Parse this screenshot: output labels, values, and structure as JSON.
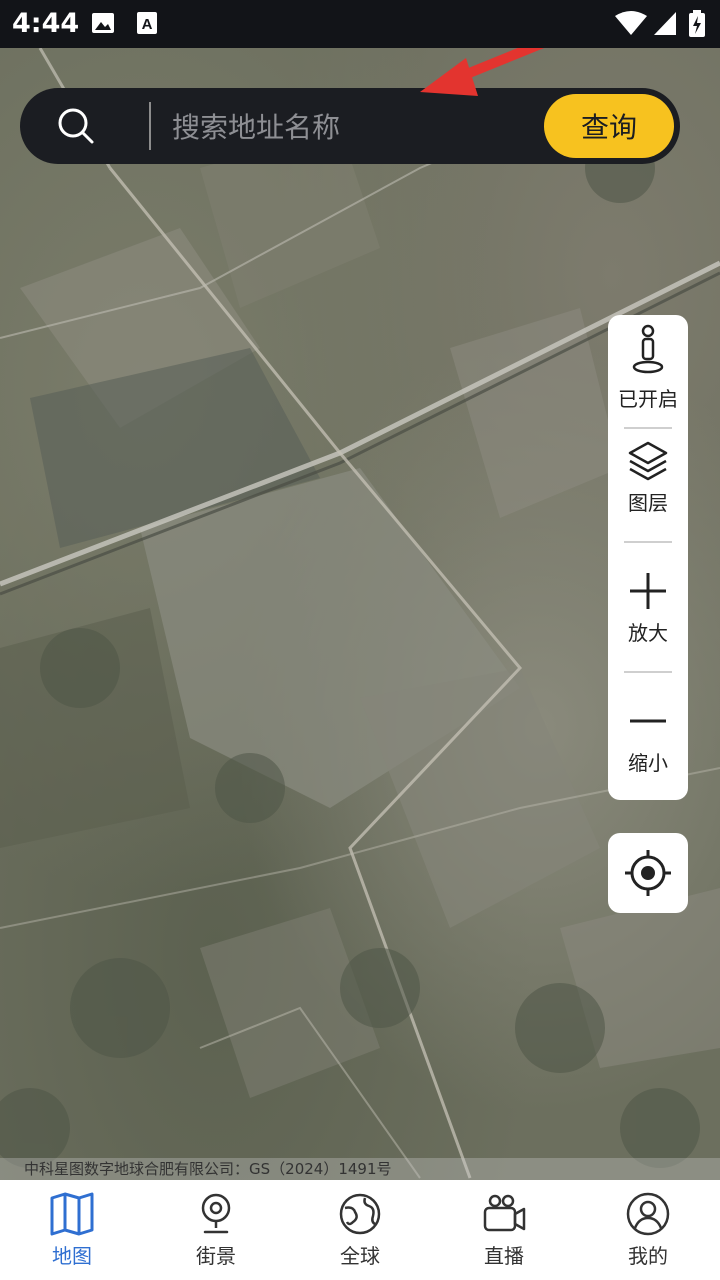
{
  "status_bar": {
    "time": "4:44",
    "icons": [
      "image-icon",
      "a-notification-icon",
      "wifi-icon",
      "signal-icon",
      "battery-charging-icon"
    ]
  },
  "search": {
    "placeholder": "搜索地址名称",
    "button_label": "查询",
    "button_color": "#f7c21f",
    "bar_color": "#1b1d22"
  },
  "toolbar": {
    "street_view_toggle": {
      "label": "已开启",
      "icon": "person-pin-icon"
    },
    "layers": {
      "label": "图层",
      "icon": "layers-icon"
    },
    "zoom_in": {
      "label": "放大",
      "icon": "plus-icon"
    },
    "zoom_out": {
      "label": "缩小",
      "icon": "minus-icon"
    }
  },
  "locate": {
    "icon": "locate-icon"
  },
  "map": {
    "copyright": "中科星图数字地球合肥有限公司：GS（2024）1491号"
  },
  "nav": {
    "active_color": "#2f6fd1",
    "items": [
      {
        "label": "地图",
        "icon": "map-icon"
      },
      {
        "label": "街景",
        "icon": "street-view-icon"
      },
      {
        "label": "全球",
        "icon": "globe-icon"
      },
      {
        "label": "直播",
        "icon": "live-camera-icon"
      },
      {
        "label": "我的",
        "icon": "profile-icon"
      }
    ]
  }
}
